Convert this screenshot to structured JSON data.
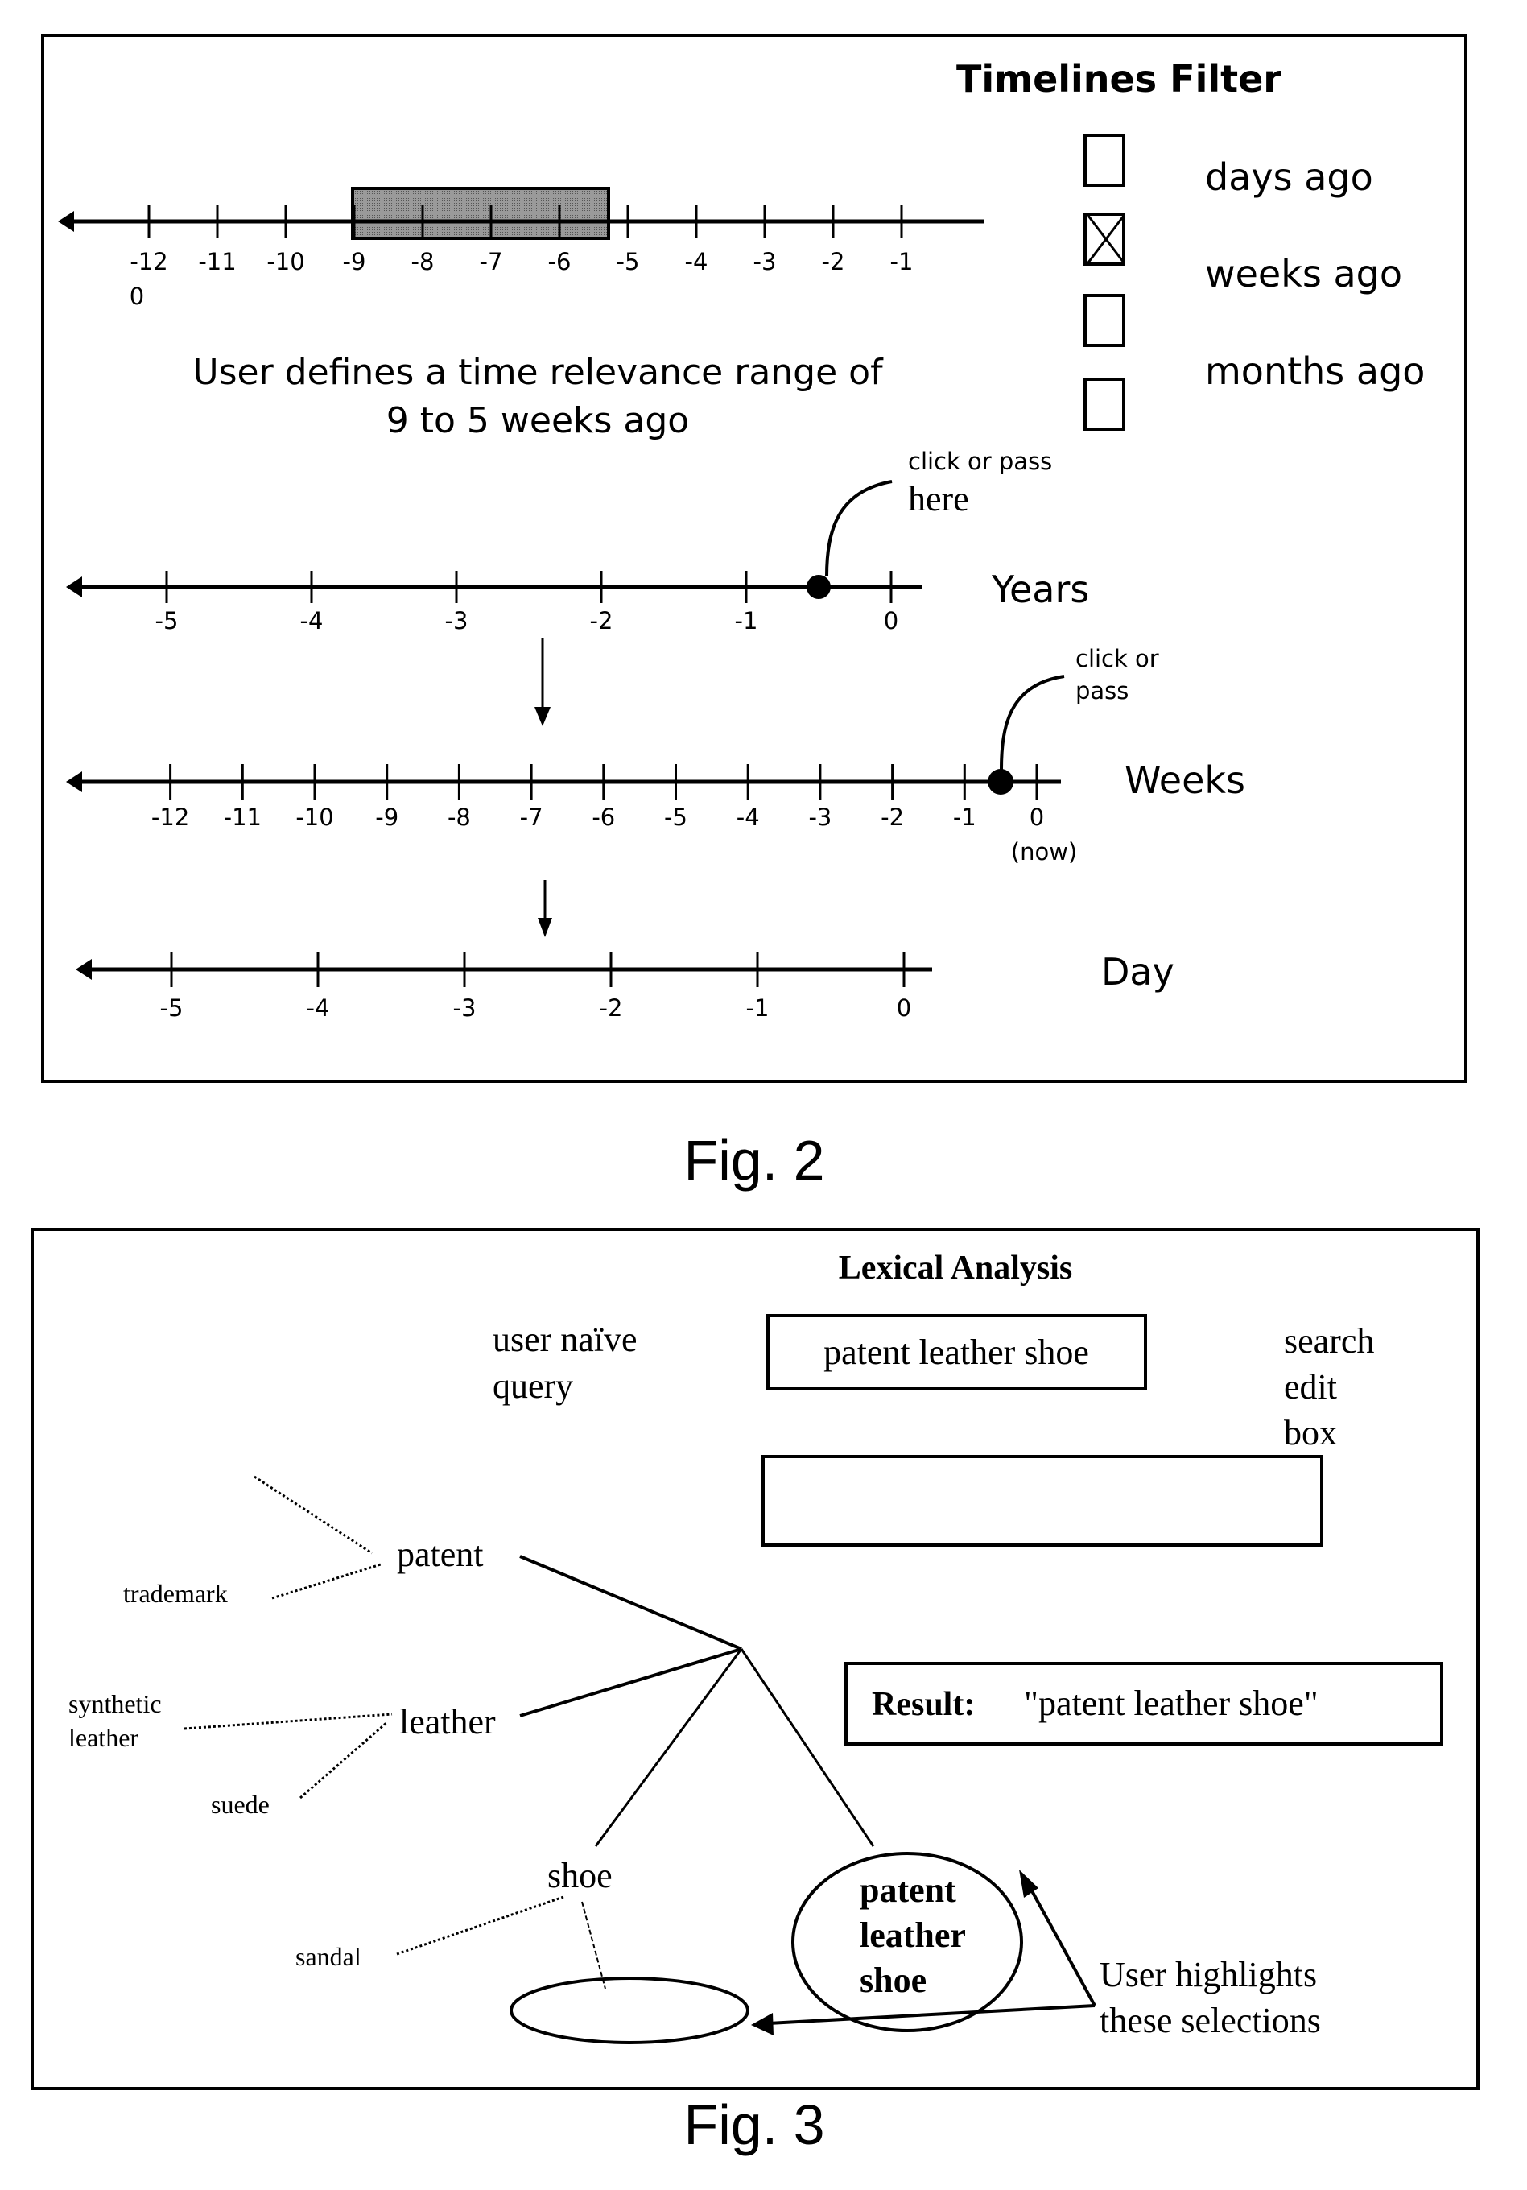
{
  "figure2": {
    "caption": "Fig. 2",
    "filter": {
      "title": "Timelines Filter",
      "checkboxes": [
        {
          "label": "days ago",
          "checked": false
        },
        {
          "label": "weeks ago",
          "checked": true
        },
        {
          "label": "",
          "checked": false
        },
        {
          "label": "months ago",
          "checked": false
        }
      ]
    },
    "range_timeline": {
      "unit": "weeks",
      "ticks": [
        "-12",
        "-11",
        "-10",
        "-9",
        "-8",
        "-7",
        "-6",
        "-5",
        "-4",
        "-3",
        "-2",
        "-1"
      ],
      "stray_label": "0",
      "selected_range": {
        "from": -9,
        "to": -5
      }
    },
    "description": {
      "line1": "User defines a time relevance range of",
      "line2": "9 to 5 weeks ago"
    },
    "years_timeline": {
      "label": "Years",
      "ticks": [
        "-5",
        "-4",
        "-3",
        "-2",
        "-1",
        "0"
      ],
      "marker_value": -0.5,
      "callout_line1": "click or pass",
      "callout_line2": "here"
    },
    "weeks_timeline": {
      "label": "Weeks",
      "ticks": [
        "-12",
        "-11",
        "-10",
        "-9",
        "-8",
        "-7",
        "-6",
        "-5",
        "-4",
        "-3",
        "-2",
        "-1",
        "0"
      ],
      "now_label": "(now)",
      "marker_value": -0.5,
      "callout_line1": "click or",
      "callout_line2": "pass"
    },
    "day_timeline": {
      "label": "Day",
      "ticks": [
        "-5",
        "-4",
        "-3",
        "-2",
        "-1",
        "0"
      ]
    }
  },
  "figure3": {
    "caption": "Fig. 3",
    "title": "Lexical Analysis",
    "naive_query_label_line1": "user naïve",
    "naive_query_label_line2": "query",
    "naive_query_value": "patent leather shoe",
    "search_edit_label": [
      "search",
      "edit",
      "box"
    ],
    "search_edit_value": "",
    "result_label": "Result:",
    "result_value": "\"patent leather shoe\"",
    "tree": {
      "terms": [
        "patent",
        "leather",
        "shoe"
      ],
      "combined_term": [
        "patent",
        "leather",
        "shoe"
      ],
      "synonyms": {
        "patent": [
          "trademark"
        ],
        "leather": [
          "synthetic",
          "leather",
          "suede"
        ],
        "shoe": [
          "sandal"
        ]
      }
    },
    "annotation_line1": "User highlights",
    "annotation_line2": "these selections"
  }
}
